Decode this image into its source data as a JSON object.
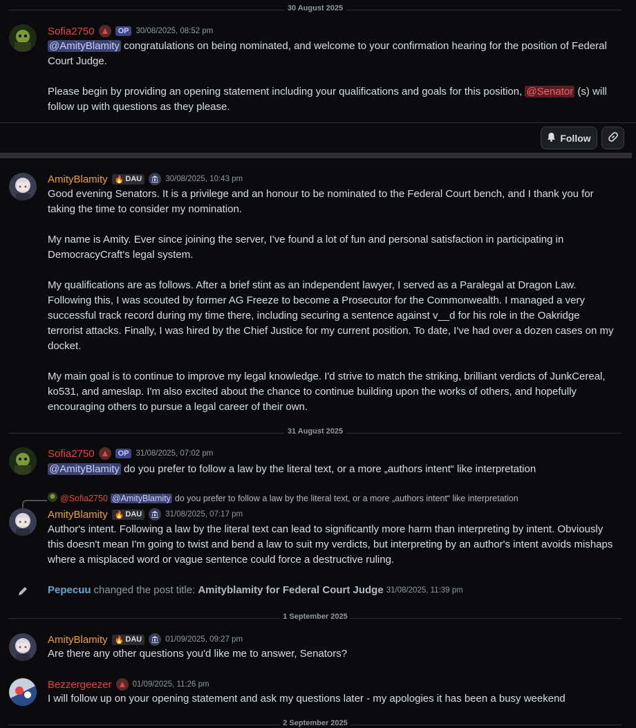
{
  "dates": [
    "30 August 2025",
    "31 August 2025",
    "1 September 2025",
    "2 September 2025"
  ],
  "buttons": {
    "follow": "Follow"
  },
  "messages": [
    {
      "author": "Sofia2750",
      "badge": "OP",
      "time": "30/08/2025, 08:52 pm",
      "mention": "@AmityBlamity",
      "line1": " congratulations on being nominated, and welcome to your confirmation hearing for the position of Federal Court Judge.",
      "para2_a": "Please begin by providing an opening statement including your qualifications and goals for this position, ",
      "role_mention": "@Senator",
      "para2_b": " (s) will follow up with questions as they please."
    },
    {
      "author": "AmityBlamity",
      "badge": "DAU",
      "time": "30/08/2025, 10:43 pm",
      "paragraphs": [
        "Good evening Senators. It is a privilege and an honour to be nominated to the Federal Court bench, and I thank you for taking the time to consider my nomination.",
        "My name is Amity. Ever since joining the server, I've found a lot of fun and personal satisfaction in participating in DemocracyCraft's legal system.",
        "My qualifications are as follows. After a brief stint as an independent lawyer, I served as a Paralegal at Dragon Law. Following this, I was scouted by former AG Freeze to become a Prosecutor for the Commonwealth. I managed a very successful track record during my time there, including securing a sentence against v__d for his role in the Oakridge terrorist attacks. Finally, I was hired by the Chief Justice for my current position. To date, I've had over a dozen cases on my docket.",
        "My main goal is to continue to improve my legal knowledge. I'd strive to match the striking, brilliant verdicts of JunkCereal, ko531, and ameslap. I'm also excited about the chance to continue building upon the works of others, and hopefully encouraging others to pursue a legal career of their own."
      ]
    },
    {
      "author": "Sofia2750",
      "badge": "OP",
      "time": "31/08/2025, 07:02 pm",
      "mention": "@AmityBlamity",
      "text": " do you prefer to follow a law by the literal text, or a more „authors intent“ like interpretation"
    },
    {
      "reply_author": "@Sofia2750",
      "reply_mention": "@AmityBlamity",
      "reply_text": "do you prefer to follow a law by the literal text, or a more „authors intent“ like interpretation",
      "author": "AmityBlamity",
      "badge": "DAU",
      "time": "31/08/2025, 07:17 pm",
      "text": "Author's intent. Following a law by the literal text can lead to significantly more harm than interpreting by intent. Obviously this doesn't mean I'm going to twist and bend a law to suit my verdicts, but interpreting by an author's intent avoids mishaps where a misplaced word or vague sentence could force a destructive ruling."
    },
    {
      "system_user": "Pepecuu",
      "system_action": "changed the post title:",
      "system_title": "Amityblamity for Federal Court Judge",
      "time": "31/08/2025, 11:39 pm"
    },
    {
      "author": "AmityBlamity",
      "badge": "DAU",
      "time": "01/09/2025, 09:27 pm",
      "text": "Are there any other questions you'd like me to answer, Senators?"
    },
    {
      "author": "Bezzergeezer",
      "time": "01/09/2025, 11:26 pm",
      "text": "I will follow up on your opening statement and ask my questions later - my apologies it has been a busy weekend"
    }
  ]
}
